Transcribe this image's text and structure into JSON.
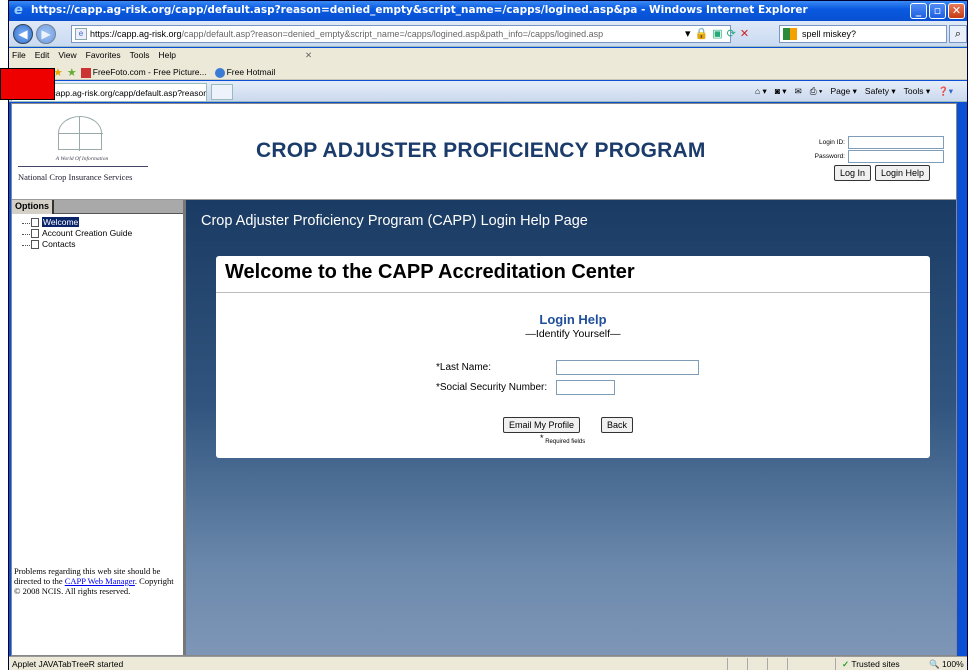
{
  "window": {
    "title": "https://capp.ag-risk.org/capp/default.asp?reason=denied_empty&script_name=/capps/logined.asp&pa - Windows Internet Explorer"
  },
  "addressbar": {
    "url_host": "https://capp.ag-risk.org",
    "url_rest": "/capp/default.asp?reason=denied_empty&script_name=/capps/logined.asp&path_info=/capps/logined.asp",
    "search_value": "spell miskey?"
  },
  "menubar": {
    "items": [
      "File",
      "Edit",
      "View",
      "Favorites",
      "Tools",
      "Help"
    ]
  },
  "favorites": {
    "links": [
      "FreeFoto.com - Free Picture...",
      "Free Hotmail"
    ]
  },
  "tab": {
    "title": "https://capp.ag-risk.org/capp/default.asp?reason=d..."
  },
  "commandbar": {
    "items": [
      "Page ▾",
      "Safety ▾",
      "Tools ▾"
    ]
  },
  "site": {
    "logo_tag": "A World Of Information",
    "logo_name": "National Crop Insurance Services",
    "title": "CROP ADJUSTER PROFICIENCY PROGRAM",
    "login_id_label": "Login ID:",
    "password_label": "Password:",
    "login_button": "Log In",
    "login_help_button": "Login Help"
  },
  "options": {
    "tab_label": "Options",
    "items": [
      "Welcome",
      "Account Creation Guide",
      "Contacts"
    ],
    "footer_prefix": "Problems regarding this web site should be directed to the ",
    "footer_link": "CAPP Web Manager",
    "footer_suffix": ". Copyright © 2008 NCIS. All rights reserved."
  },
  "main": {
    "heading": "Crop Adjuster Proficiency Program (CAPP) Login Help Page",
    "panel_title": "Welcome to the CAPP Accreditation Center",
    "login_help_title": "Login Help",
    "login_help_sub": "—Identify Yourself—",
    "last_name_label": "*Last Name:",
    "ssn_label": "*Social Security Number:",
    "email_button": "Email My Profile",
    "back_button": "Back",
    "required_note": "Required fields"
  },
  "statusbar": {
    "left_text": "Applet JAVATabTreeR started",
    "zone": "Trusted sites",
    "zoom": "100%"
  }
}
